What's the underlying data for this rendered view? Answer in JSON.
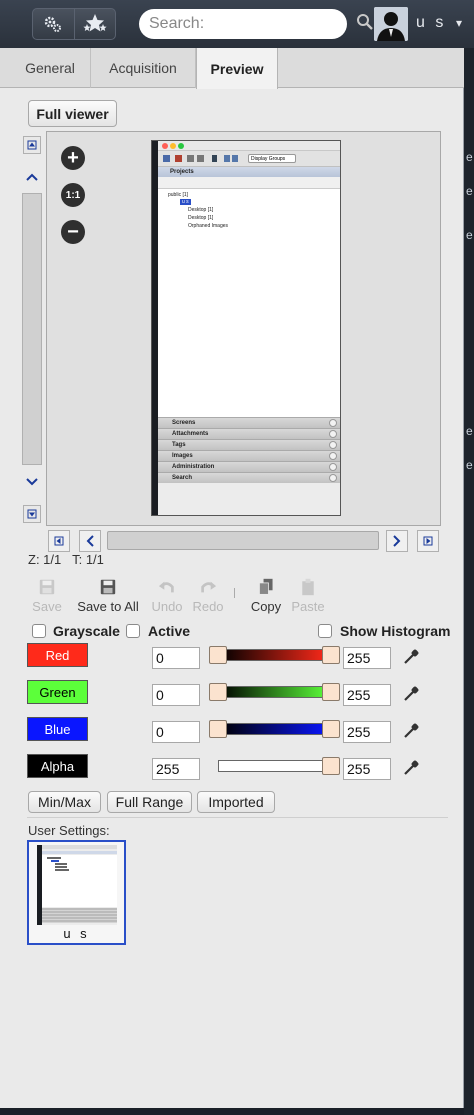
{
  "topbar": {
    "search_placeholder": "Search:",
    "user_name": "u s",
    "dropdown_glyph": "▾",
    "icons": [
      "settings-gears-icon",
      "stars-icon",
      "search-icon",
      "user-avatar-icon"
    ]
  },
  "tabs": [
    {
      "label": "General",
      "active": false
    },
    {
      "label": "Acquisition",
      "active": false
    },
    {
      "label": "Preview",
      "active": true
    }
  ],
  "viewer": {
    "full_viewer_label": "Full viewer",
    "zoom_in": "+",
    "zoom_reset": "1:1",
    "zoom_out": "−",
    "z_label": "Z: 1/1",
    "t_label": "T: 1/1",
    "thumbnail": {
      "toolbar_dropdown": "Display Groups",
      "projects_header": "Projects",
      "tree": [
        "public [1]",
        "u s",
        "Desktop [1]",
        "Desktop [1]",
        "Orphaned Images"
      ],
      "sections": [
        "Screens",
        "Attachments",
        "Tags",
        "Images",
        "Administration",
        "Search"
      ]
    }
  },
  "actions": [
    {
      "label": "Save",
      "enabled": false,
      "icon": "floppy-disk-icon"
    },
    {
      "label": "Save to All",
      "enabled": true,
      "icon": "floppy-disk-icon"
    },
    {
      "label": "Undo",
      "enabled": false,
      "icon": "undo-arrow-icon"
    },
    {
      "label": "Redo",
      "enabled": false,
      "icon": "redo-arrow-icon"
    },
    {
      "label": "Copy",
      "enabled": true,
      "icon": "copy-icon"
    },
    {
      "label": "Paste",
      "enabled": false,
      "icon": "paste-icon"
    }
  ],
  "options": {
    "grayscale": "Grayscale",
    "active": "Active",
    "show_histogram": "Show Histogram"
  },
  "channels": [
    {
      "name": "Red",
      "color": "#ff2a1a",
      "text_color": "#ffffff",
      "min": "0",
      "max": "255",
      "grad_from": "#000000",
      "grad_to": "#ff2a1a"
    },
    {
      "name": "Green",
      "color": "#5cff3a",
      "text_color": "#000000",
      "min": "0",
      "max": "255",
      "grad_from": "#000000",
      "grad_to": "#5cff3a"
    },
    {
      "name": "Blue",
      "color": "#0a16ff",
      "text_color": "#ffffff",
      "min": "0",
      "max": "255",
      "grad_from": "#000000",
      "grad_to": "#0a16ff"
    },
    {
      "name": "Alpha",
      "color": "#000000",
      "text_color": "#ffffff",
      "min": "255",
      "max": "255",
      "grad_from": "#ffffff",
      "grad_to": "#ffffff"
    }
  ],
  "range_buttons": [
    "Min/Max",
    "Full Range",
    "Imported"
  ],
  "user_settings": {
    "label": "User Settings:",
    "card_name": "u s"
  },
  "right_strip_chars": [
    "e",
    "e",
    "e",
    "e",
    "e"
  ]
}
